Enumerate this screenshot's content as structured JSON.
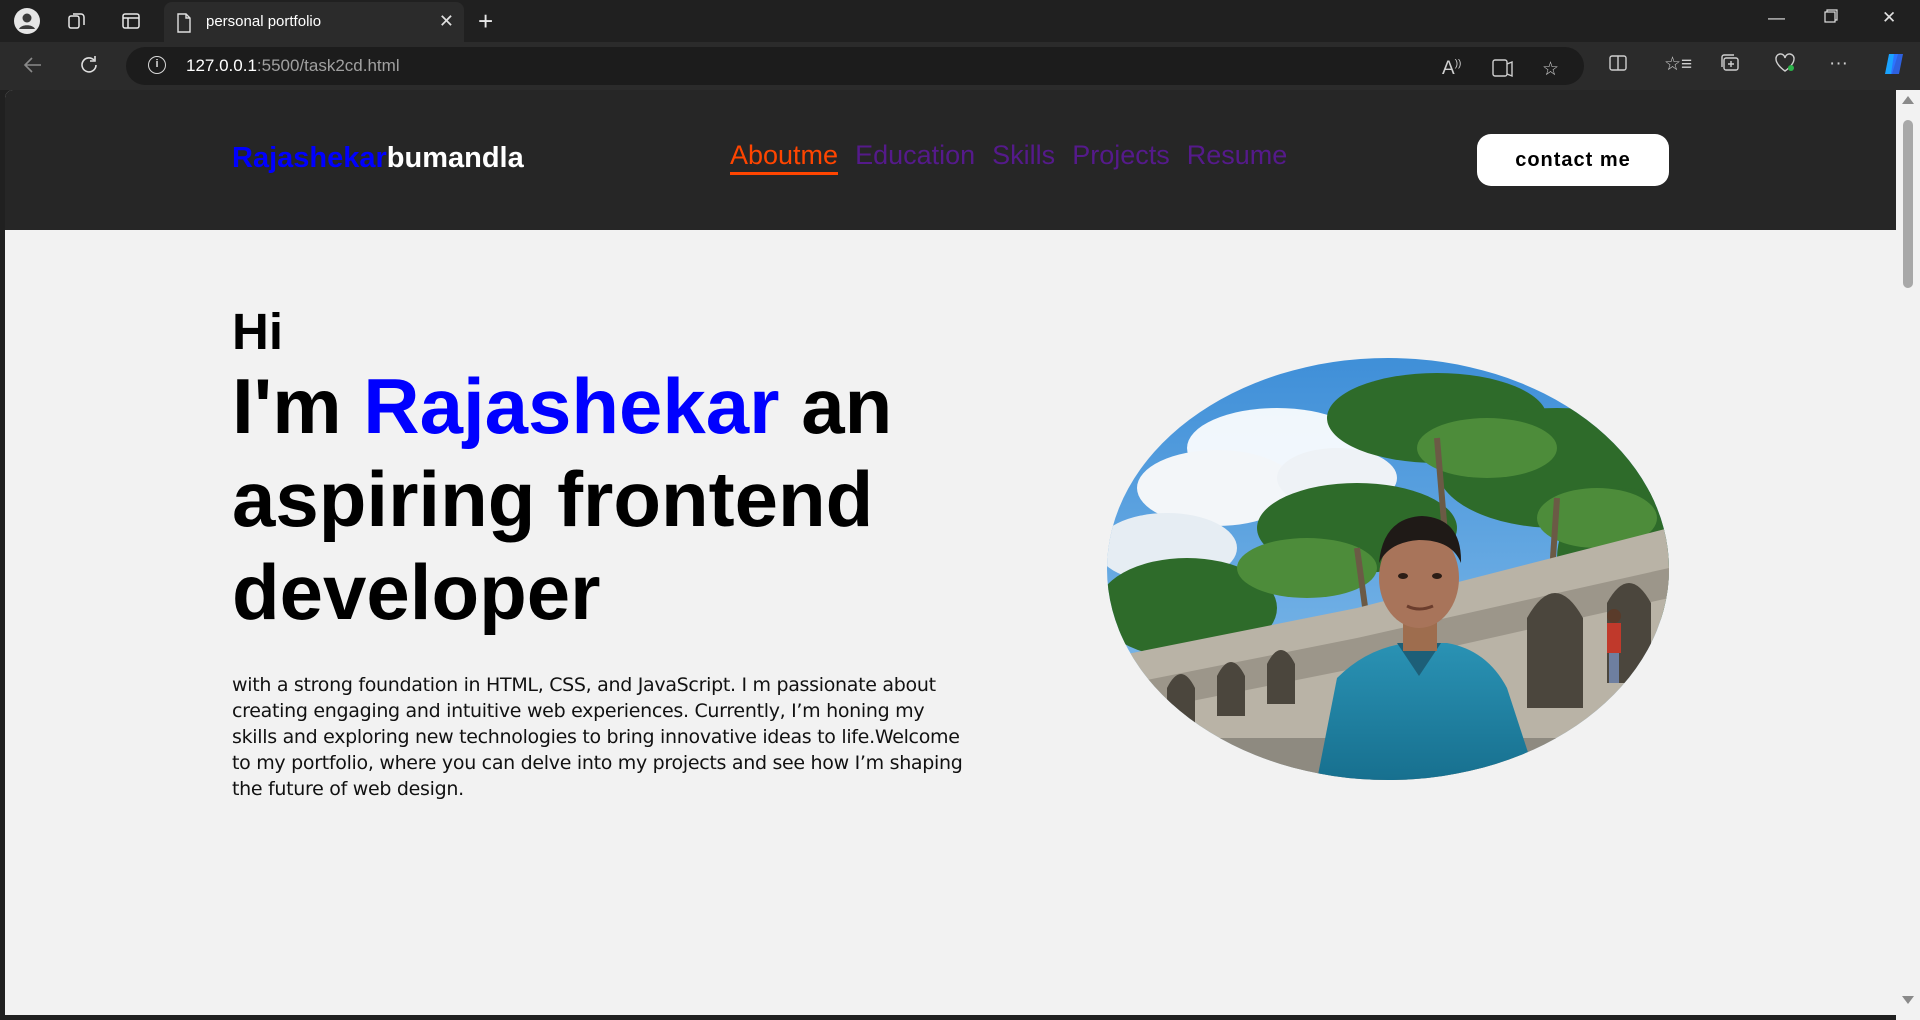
{
  "browser": {
    "tab_title": "personal portfolio",
    "url_host": "127.0.0.1",
    "url_rest": ":5500/task2cd.html",
    "icons": [
      "profile-icon",
      "workspaces-icon",
      "tab-actions-icon",
      "page-icon",
      "close-icon",
      "new-tab-icon",
      "minimize-icon",
      "restore-icon",
      "window-close-icon",
      "back-icon",
      "refresh-icon",
      "info-icon",
      "read-aloud-icon",
      "immersive-reader-icon",
      "favorite-icon",
      "split-screen-icon",
      "favorites-icon",
      "collections-icon",
      "browser-essentials-icon",
      "more-icon",
      "copilot-icon"
    ]
  },
  "site": {
    "logo_first": "Rajashekar",
    "logo_last": "bumandla",
    "nav": [
      {
        "label": "Aboutme",
        "active": true
      },
      {
        "label": "Education",
        "active": false
      },
      {
        "label": "Skills",
        "active": false
      },
      {
        "label": "Projects",
        "active": false
      },
      {
        "label": "Resume",
        "active": false
      }
    ],
    "contact_label": "contact me"
  },
  "hero": {
    "hi": "Hi",
    "prefix": "I'm ",
    "name": "Rajashekar",
    "suffix": " an aspiring frontend developer",
    "description": "with a strong foundation in HTML, CSS, and JavaScript. I m passionate about creating engaging and intuitive web experiences. Currently, I’m honing my skills and exploring new technologies to bring innovative ideas to life.Welcome to my portfolio, where you can delve into my projects and see how I’m shaping the future of web design."
  },
  "colors": {
    "logo_first": "#0000ff",
    "nav_active": "#ff4500",
    "nav_link": "#551a8b",
    "hero_name": "#0000ff",
    "header_bg": "#262626",
    "page_bg": "#f2f2f2"
  }
}
